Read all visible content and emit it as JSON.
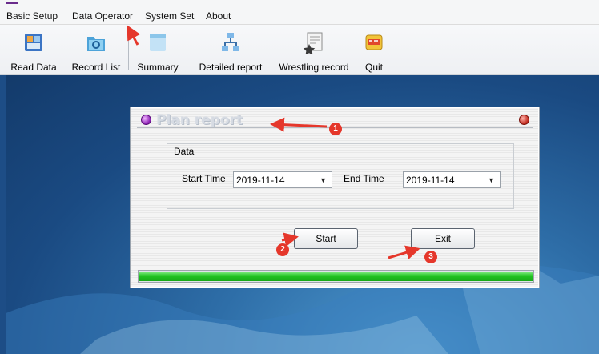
{
  "menu": {
    "items": [
      "Basic Setup",
      "Data Operator",
      "System Set",
      "About"
    ]
  },
  "toolbar": {
    "buttons": [
      {
        "label": "Read Data",
        "icon": "read-data-icon"
      },
      {
        "label": "Record List",
        "icon": "record-list-icon"
      },
      {
        "label": "Summary",
        "icon": "summary-icon"
      },
      {
        "label": "Detailed report",
        "icon": "detailed-report-icon"
      },
      {
        "label": "Wrestling record",
        "icon": "wrestling-record-icon"
      },
      {
        "label": "Quit",
        "icon": "quit-icon"
      }
    ]
  },
  "dialog": {
    "title": "Plan report",
    "group_label": "Data",
    "start_time_label": "Start Time",
    "start_time_value": "2019-11-14",
    "end_time_label": "End Time",
    "end_time_value": "2019-11-14",
    "start_button": "Start",
    "exit_button": "Exit",
    "progress": 1.0
  },
  "annotations": {
    "markers": [
      "1",
      "2",
      "3"
    ],
    "color": "#e5372b"
  }
}
